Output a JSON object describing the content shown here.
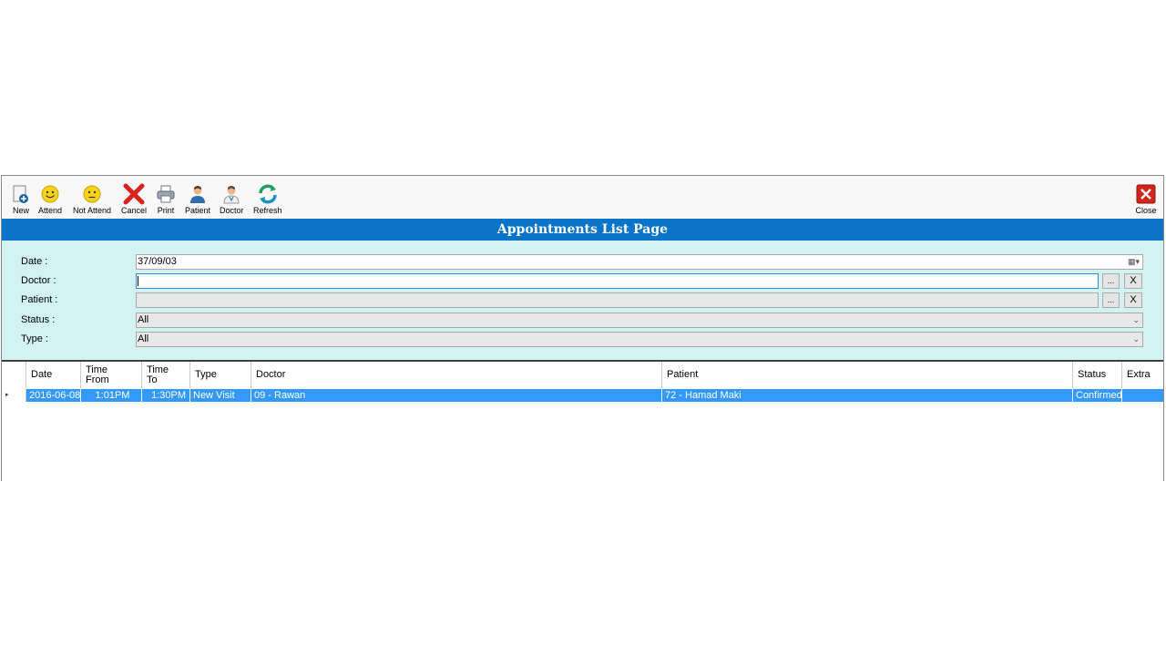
{
  "toolbar": {
    "new": "New",
    "attend": "Attend",
    "not_attend": "Not Attend",
    "cancel": "Cancel",
    "print": "Print",
    "patient": "Patient",
    "doctor": "Doctor",
    "refresh": "Refresh",
    "close": "Close"
  },
  "page_title": "Appointments List Page",
  "filters": {
    "date_label": "Date :",
    "date_value": "37/09/03",
    "doctor_label": "Doctor :",
    "doctor_value": "",
    "patient_label": "Patient :",
    "patient_value": "",
    "status_label": "Status :",
    "status_value": "All",
    "type_label": "Type :",
    "type_value": "All",
    "browse_label": "...",
    "clear_label": "X"
  },
  "grid": {
    "columns": [
      "Date",
      "Time\nFrom",
      "Time\nTo",
      "Type",
      "Doctor",
      "Patient",
      "Status",
      "Extra"
    ],
    "rows": [
      {
        "date": "2016-06-08",
        "time_from": "1:01PM",
        "time_to": "1:30PM",
        "type": "New Visit",
        "doctor": "09 - Rawan",
        "patient": "72 - Hamad Maki",
        "status": "Confirmed",
        "extra": ""
      }
    ],
    "row_indicator": "▸"
  },
  "colors": {
    "title_bar": "#0a74c9",
    "filter_panel": "#d3f2f2",
    "selected_row": "#3399ff"
  }
}
